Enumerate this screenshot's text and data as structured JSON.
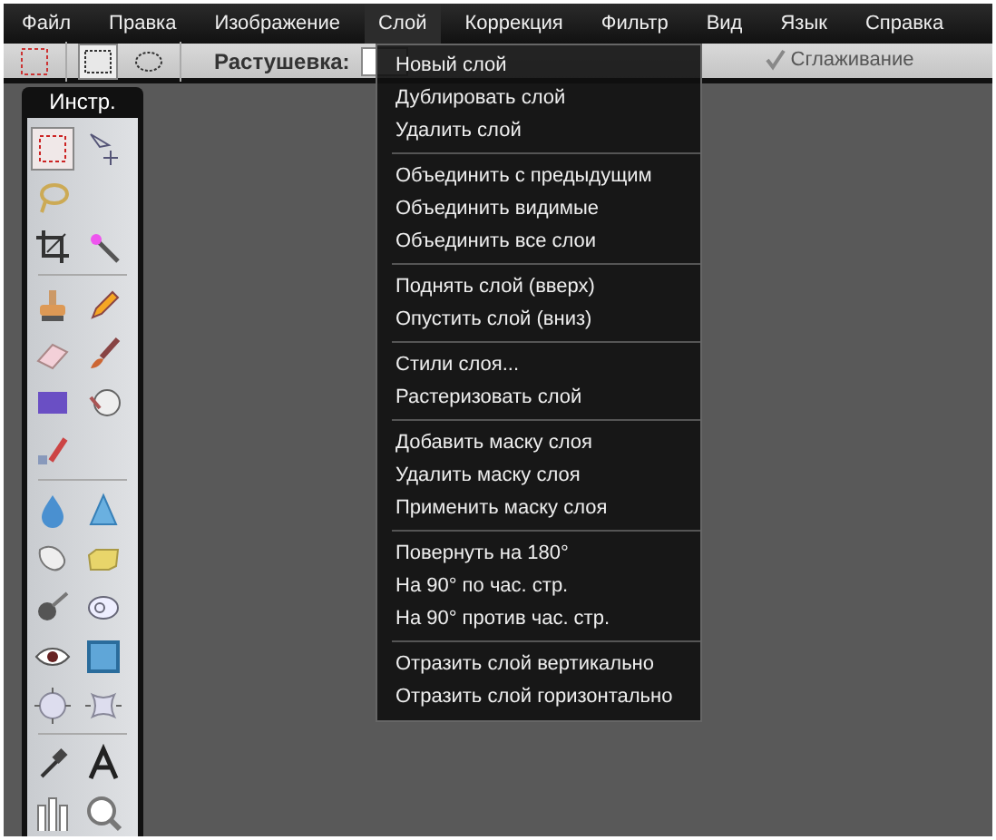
{
  "menubar": [
    {
      "label": "Файл",
      "selected": false
    },
    {
      "label": "Правка",
      "selected": false
    },
    {
      "label": "Изображение",
      "selected": false
    },
    {
      "label": "Слой",
      "selected": true
    },
    {
      "label": "Коррекция",
      "selected": false
    },
    {
      "label": "Фильтр",
      "selected": false
    },
    {
      "label": "Вид",
      "selected": false
    },
    {
      "label": "Язык",
      "selected": false
    },
    {
      "label": "Справка",
      "selected": false
    }
  ],
  "options_bar": {
    "shapes": [
      {
        "selected": true
      },
      {
        "selected": false
      }
    ],
    "feather_label": "Растушевка:",
    "antialias": {
      "label": "Сглаживание",
      "checked": true
    }
  },
  "dropdown": {
    "groups": [
      [
        "Новый слой",
        "Дублировать слой",
        "Удалить слой"
      ],
      [
        "Объединить с предыдущим",
        "Объединить видимые",
        "Объединить все слои"
      ],
      [
        "Поднять слой (вверх)",
        "Опустить слой (вниз)"
      ],
      [
        "Стили слоя...",
        "Растеризовать слой"
      ],
      [
        "Добавить маску слоя",
        "Удалить маску слоя",
        "Применить маску слоя"
      ],
      [
        "Повернуть на 180°",
        "На 90° по час. стр.",
        "На 90° против час. стр."
      ],
      [
        "Отразить слой вертикально",
        "Отразить слой горизонтально"
      ]
    ]
  },
  "tools_panel": {
    "title": "Инстр.",
    "groups": [
      [
        [
          {
            "selected": true
          },
          {
            "selected": false
          }
        ],
        [
          {
            "selected": false
          }
        ],
        [
          {
            "selected": false
          },
          {
            "selected": false
          }
        ]
      ],
      [
        [
          {
            "selected": false
          },
          {
            "selected": false
          }
        ],
        [
          {
            "selected": false
          },
          {
            "selected": false
          }
        ],
        [
          {
            "selected": false
          },
          {
            "selected": false
          }
        ],
        [
          {
            "selected": false
          }
        ]
      ],
      [
        [
          {
            "selected": false
          },
          {
            "selected": false
          }
        ],
        [
          {
            "selected": false
          },
          {
            "selected": false
          }
        ],
        [
          {
            "selected": false
          },
          {
            "selected": false
          }
        ],
        [
          {
            "selected": false
          },
          {
            "selected": false
          }
        ],
        [
          {
            "selected": false
          },
          {
            "selected": false
          }
        ]
      ],
      [
        [
          {
            "selected": false
          },
          {
            "selected": false
          }
        ],
        [
          {
            "selected": false
          },
          {
            "selected": false
          }
        ]
      ]
    ]
  }
}
